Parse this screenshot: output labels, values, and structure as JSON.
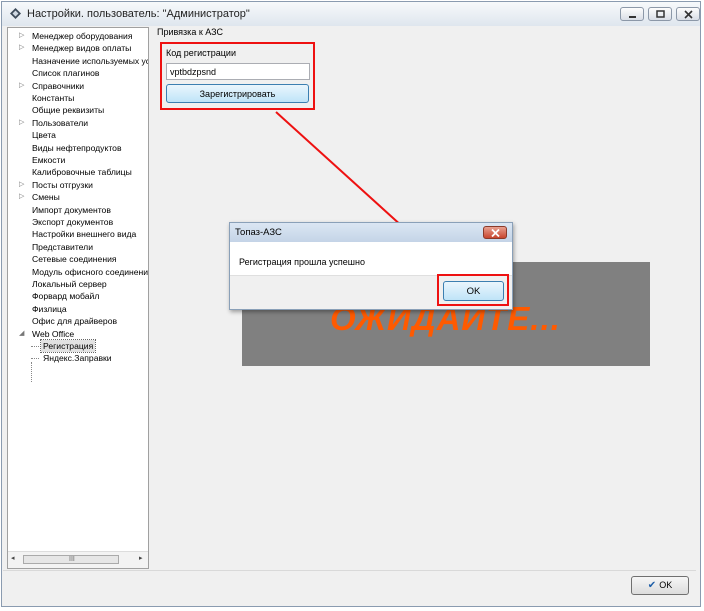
{
  "window": {
    "title": "Настройки. пользователь: \"Администратор\"",
    "icons": [
      "settings-diamond-icon",
      "minimize-icon",
      "maximize-icon",
      "close-icon"
    ]
  },
  "sidebar": {
    "items": [
      {
        "label": "Менеджер оборудования",
        "expandable": true
      },
      {
        "label": "Менеджер видов оплаты",
        "expandable": true
      },
      {
        "label": "Назначение используемых устройств",
        "expandable": false
      },
      {
        "label": "Список плагинов",
        "expandable": false
      },
      {
        "label": "Справочники",
        "expandable": true
      },
      {
        "label": "Константы",
        "expandable": false
      },
      {
        "label": "Общие реквизиты",
        "expandable": false
      },
      {
        "label": "Пользователи",
        "expandable": true
      },
      {
        "label": "Цвета",
        "expandable": false
      },
      {
        "label": "Виды нефтепродуктов",
        "expandable": false
      },
      {
        "label": "Емкости",
        "expandable": false
      },
      {
        "label": "Калибровочные таблицы",
        "expandable": false
      },
      {
        "label": "Посты отгрузки",
        "expandable": true
      },
      {
        "label": "Смены",
        "expandable": true
      },
      {
        "label": "Импорт документов",
        "expandable": false
      },
      {
        "label": "Экспорт документов",
        "expandable": false
      },
      {
        "label": "Настройки внешнего вида",
        "expandable": false
      },
      {
        "label": "Представители",
        "expandable": false
      },
      {
        "label": "Сетевые соединения",
        "expandable": false
      },
      {
        "label": "Модуль офисного соединения",
        "expandable": false
      },
      {
        "label": "Локальный сервер",
        "expandable": false
      },
      {
        "label": "Форвард мобайл",
        "expandable": false
      },
      {
        "label": "Физлица",
        "expandable": false
      },
      {
        "label": "Офис для драйверов",
        "expandable": false
      },
      {
        "label": "Web Office",
        "expandable": true,
        "expanded": true
      }
    ],
    "children": [
      {
        "label": "Регистрация",
        "selected": true
      },
      {
        "label": "Яндекс.Заправки",
        "selected": false
      }
    ],
    "scrollbar": {
      "grip": "III"
    }
  },
  "main": {
    "section_title": "Привязка к АЗС",
    "reg_label": "Код регистрации",
    "reg_value": "vptbdzpsnd",
    "register_button": "Зарегистрировать",
    "overlay_text": "ОЖИДАЙТЕ..."
  },
  "dialog": {
    "title": "Топаз-АЗС",
    "message": "Регистрация прошла успешно",
    "ok_label": "OK"
  },
  "footer": {
    "ok_label": "OK"
  },
  "annotation_color": "#e11111"
}
